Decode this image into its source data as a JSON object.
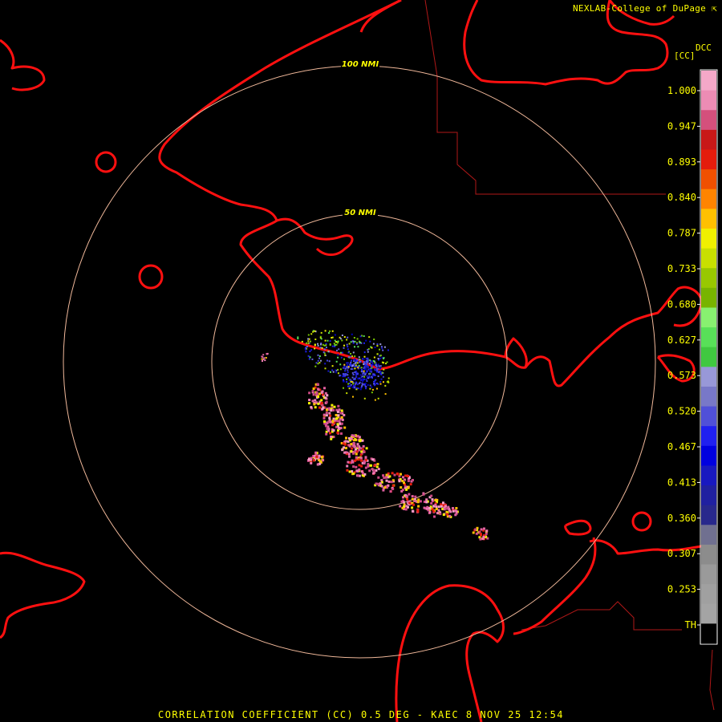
{
  "header": {
    "credit": "NEXLAB-College of DuPage",
    "product_code": "DCC",
    "unit": "[CC]"
  },
  "footer": {
    "caption": "CORRELATION COEFFICIENT (CC) 0.5 DEG - KAEC 8 NOV 25 12:54"
  },
  "range_rings": [
    {
      "label": "50 NMI"
    },
    {
      "label": "100 NMI"
    }
  ],
  "color_scale": {
    "labels": [
      "1.000",
      "0.947",
      "0.893",
      "0.840",
      "0.787",
      "0.733",
      "0.680",
      "0.627",
      "0.573",
      "0.520",
      "0.467",
      "0.413",
      "0.360",
      "0.307",
      "0.253",
      "TH"
    ],
    "colors": [
      "#f4a8c8",
      "#ec8cb4",
      "#d4507c",
      "#c81818",
      "#e41c0c",
      "#f05000",
      "#ff8400",
      "#ffc000",
      "#f0f000",
      "#c8e000",
      "#98c800",
      "#78b400",
      "#88f070",
      "#58e058",
      "#40c840",
      "#9898d8",
      "#7878c8",
      "#5050d8",
      "#2020f0",
      "#0000e0",
      "#1818c0",
      "#2020a0",
      "#28288c",
      "#707090",
      "#8c8c8c",
      "#9a9a9a",
      "#a0a0a0",
      "#a4a4a4",
      "#000000"
    ]
  },
  "legend_icons": {
    "credit_icon": "arrow-cursor-icon"
  }
}
